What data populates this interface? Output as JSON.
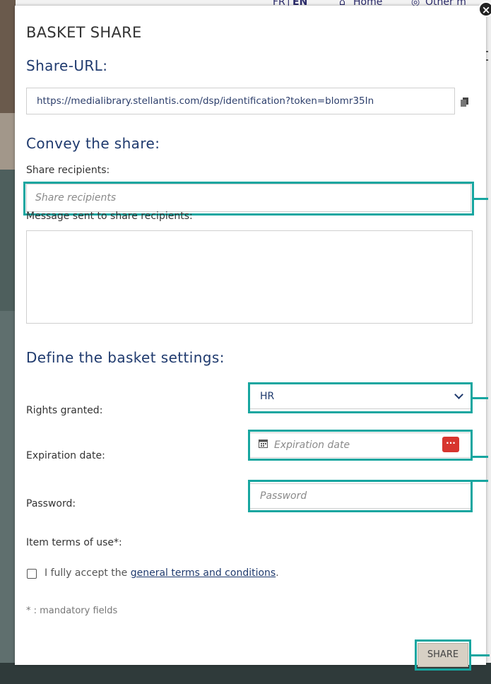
{
  "background": {
    "lang_fr": "FR",
    "lang_sep": "|",
    "lang_en": "EN",
    "home": "Home",
    "other": "Other m"
  },
  "modal": {
    "title": "BASKET SHARE",
    "close_label": "×",
    "share_url_heading": "Share-URL:",
    "share_url_value": "https://medialibrary.stellantis.com/dsp/identification?token=blomr35In",
    "convey_heading": "Convey the share:",
    "recipients_label": "Share recipients:",
    "recipients_placeholder": "Share recipients",
    "message_label": "Message sent to share recipients:",
    "settings_heading": "Define the basket settings:",
    "rights_label": "Rights granted:",
    "rights_value": "HR",
    "expiration_label": "Expiration date:",
    "expiration_placeholder": "Expiration date",
    "calendar_button": "···",
    "password_label": "Password:",
    "password_placeholder": "Password",
    "terms_label": "Item terms of use*:",
    "accept_prefix": "I fully accept the ",
    "accept_link": "general terms and conditions",
    "accept_suffix": ".",
    "mandatory_note": "* : mandatory fields",
    "share_button": "SHARE"
  },
  "colors": {
    "heading": "#1f3a6e",
    "highlight": "#17a6a0",
    "calendar_button": "#d7352e",
    "share_button_bg": "#d7d0c4"
  },
  "icons": [
    "close-icon",
    "copy-icon",
    "home-icon",
    "calendar-icon",
    "chevron-down-icon"
  ]
}
